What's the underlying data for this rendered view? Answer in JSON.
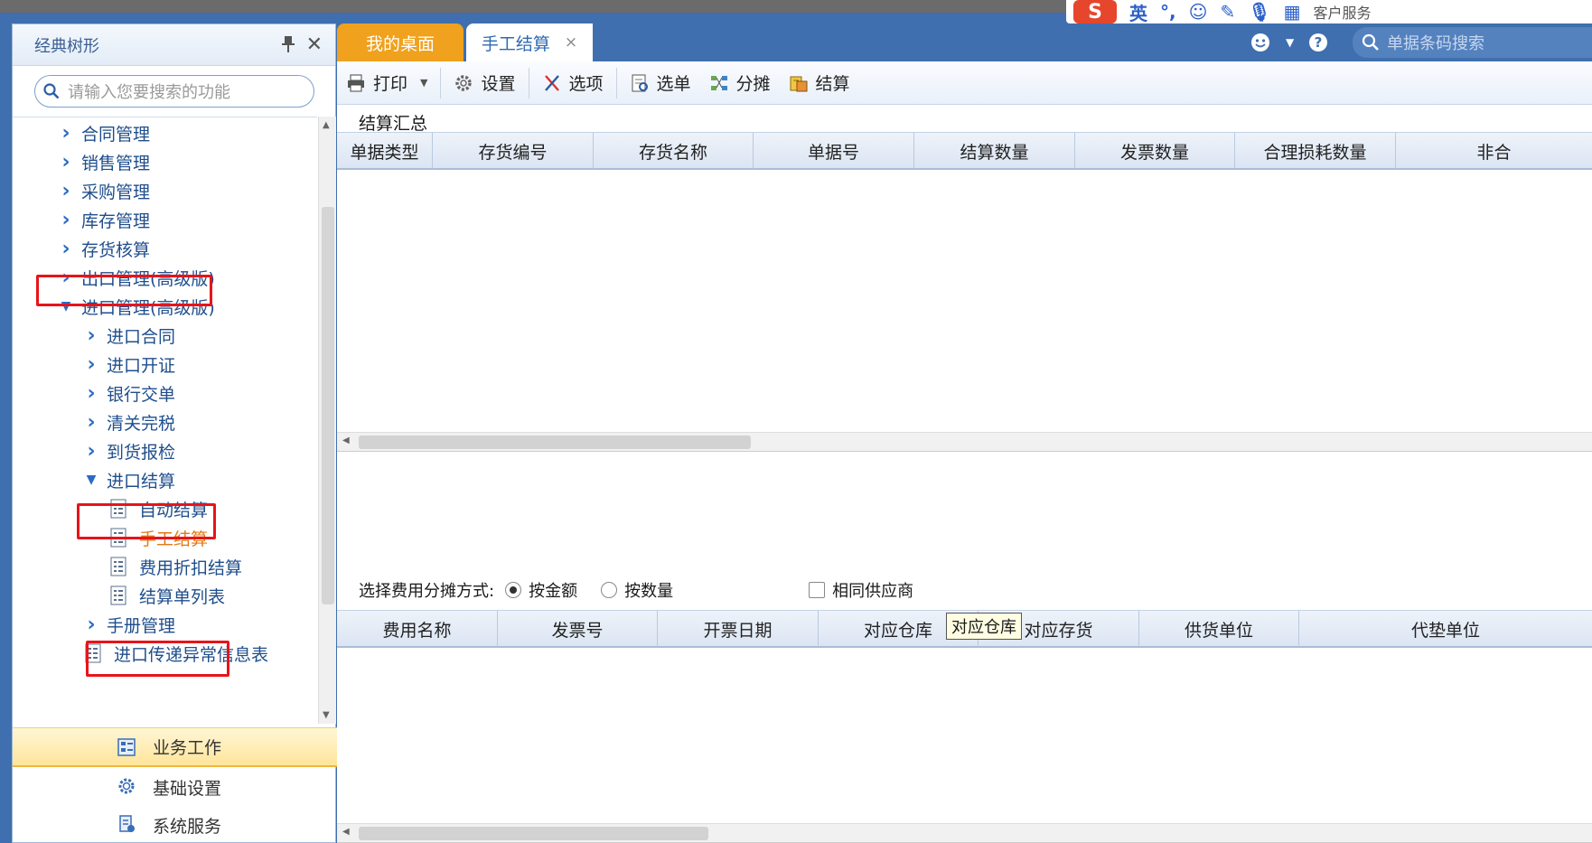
{
  "ime_bar": {
    "label_en": "英",
    "label_service": "客户服务"
  },
  "left_panel": {
    "title": "经典树形",
    "search_placeholder": "请输入您要搜索的功能",
    "tree": [
      {
        "label": "合同管理",
        "level": 0,
        "type": "folder",
        "expanded": false
      },
      {
        "label": "销售管理",
        "level": 0,
        "type": "folder",
        "expanded": false
      },
      {
        "label": "采购管理",
        "level": 0,
        "type": "folder",
        "expanded": false
      },
      {
        "label": "库存管理",
        "level": 0,
        "type": "folder",
        "expanded": false
      },
      {
        "label": "存货核算",
        "level": 0,
        "type": "folder",
        "expanded": false
      },
      {
        "label": "出口管理(高级版)",
        "level": 0,
        "type": "folder",
        "expanded": false
      },
      {
        "label": "进口管理(高级版)",
        "level": 0,
        "type": "folder",
        "expanded": true
      },
      {
        "label": "进口合同",
        "level": 1,
        "type": "folder",
        "expanded": false
      },
      {
        "label": "进口开证",
        "level": 1,
        "type": "folder",
        "expanded": false
      },
      {
        "label": "银行交单",
        "level": 1,
        "type": "folder",
        "expanded": false
      },
      {
        "label": "清关完税",
        "level": 1,
        "type": "folder",
        "expanded": false
      },
      {
        "label": "到货报检",
        "level": 1,
        "type": "folder",
        "expanded": false
      },
      {
        "label": "进口结算",
        "level": 1,
        "type": "folder",
        "expanded": true
      },
      {
        "label": "自动结算",
        "level": 2,
        "type": "doc"
      },
      {
        "label": "手工结算",
        "level": 2,
        "type": "doc",
        "active": true
      },
      {
        "label": "费用折扣结算",
        "level": 2,
        "type": "doc"
      },
      {
        "label": "结算单列表",
        "level": 2,
        "type": "doc"
      },
      {
        "label": "手册管理",
        "level": 1,
        "type": "folder",
        "expanded": false
      },
      {
        "label": "进口传递异常信息表",
        "level": 1,
        "type": "doc"
      }
    ],
    "bottom_nav": [
      {
        "label": "业务工作",
        "selected": true
      },
      {
        "label": "基础设置",
        "selected": false
      },
      {
        "label": "系统服务",
        "selected": false
      }
    ]
  },
  "tabs": [
    {
      "label": "我的桌面",
      "active": false
    },
    {
      "label": "手工结算",
      "active": true,
      "close": "×"
    }
  ],
  "top_search_placeholder": "单据条码搜索",
  "toolbar": {
    "print": "打印",
    "settings": "设置",
    "options": "选项",
    "select_doc": "选单",
    "allocate": "分摊",
    "settle": "结算"
  },
  "summary": {
    "title": "结算汇总",
    "columns": [
      "单据类型",
      "存货编号",
      "存货名称",
      "单据号",
      "结算数量",
      "发票数量",
      "合理损耗数量",
      "非合"
    ]
  },
  "allocation": {
    "label": "选择费用分摊方式:",
    "by_amount": "按金额",
    "by_quantity": "按数量",
    "selected": "by_amount",
    "same_supplier": "相同供应商"
  },
  "expense": {
    "columns": [
      "费用名称",
      "发票号",
      "开票日期",
      "对应仓库",
      "对应存货",
      "供货单位",
      "代垫单位"
    ]
  },
  "tooltip": "对应仓库",
  "colors": {
    "accent_blue": "#3f6fae",
    "tab_orange": "#f0a11e",
    "highlight_red": "#e8141a",
    "active_orange": "#e07a16"
  }
}
